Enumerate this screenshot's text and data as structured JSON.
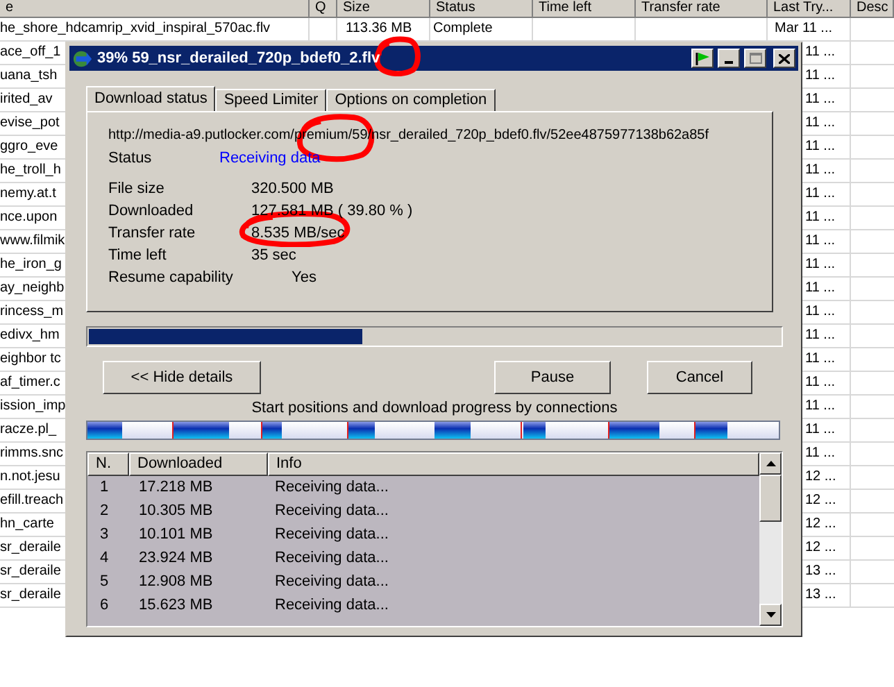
{
  "file_list": {
    "columns": [
      "e",
      "Q",
      "Size",
      "Status",
      "Time left",
      "Transfer rate",
      "Last Try...",
      "Desc"
    ],
    "rows": [
      {
        "name": "he_shore_hdcamrip_xvid_inspiral_570ac.flv",
        "size": "113.36  MB",
        "status": "Complete",
        "last_try": "Mar 11 ..."
      },
      {
        "name": "ace_off_1",
        "last_try": "11 ..."
      },
      {
        "name": "uana_tsh",
        "last_try": "11 ..."
      },
      {
        "name": "irited_av",
        "last_try": "11 ..."
      },
      {
        "name": "evise_pot",
        "last_try": "11 ..."
      },
      {
        "name": "ggro_eve",
        "last_try": "11 ..."
      },
      {
        "name": "he_troll_h",
        "last_try": "11 ..."
      },
      {
        "name": "nemy.at.t",
        "last_try": "11 ..."
      },
      {
        "name": "nce.upon",
        "last_try": "11 ..."
      },
      {
        "name": "www.filmik",
        "last_try": "11 ..."
      },
      {
        "name": "he_iron_g",
        "last_try": "11 ..."
      },
      {
        "name": "ay_neighb",
        "last_try": "11 ..."
      },
      {
        "name": "rincess_m",
        "last_try": "11 ..."
      },
      {
        "name": "edivx_hm",
        "last_try": "11 ..."
      },
      {
        "name": "eighbor tc",
        "last_try": "11 ..."
      },
      {
        "name": "af_timer.c",
        "last_try": "11 ..."
      },
      {
        "name": "ission_imp",
        "last_try": "11 ..."
      },
      {
        "name": "racze.pl_",
        "last_try": "11 ..."
      },
      {
        "name": "rimms.snc",
        "last_try": "11 ..."
      },
      {
        "name": "n.not.jesu",
        "last_try": "12 ..."
      },
      {
        "name": "efill.treach",
        "last_try": "12 ..."
      },
      {
        "name": "hn_carte",
        "last_try": "12 ..."
      },
      {
        "name": "sr_deraile",
        "last_try": "12 ..."
      },
      {
        "name": "sr_deraile",
        "last_try": "13 ..."
      },
      {
        "name": "sr_deraile",
        "last_try": "13 ..."
      }
    ]
  },
  "dialog": {
    "title": "39% 59_nsr_derailed_720p_bdef0_2.flv",
    "tabs": [
      {
        "label": "Download status",
        "selected": true
      },
      {
        "label": "Speed Limiter",
        "selected": false
      },
      {
        "label": "Options on completion",
        "selected": false
      }
    ],
    "url": "http://media-a9.putlocker.com/premium/59/nsr_derailed_720p_bdef0.flv/52ee4875977138b62a85f",
    "status": {
      "label": "Status",
      "value": "Receiving data"
    },
    "details": [
      {
        "label": "File size",
        "value": "320.500  MB",
        "kind": "plain"
      },
      {
        "label": "Downloaded",
        "value": "127.581  MB  ( 39.80 % )",
        "kind": "plain"
      },
      {
        "label": "Transfer rate",
        "value": "8.535  MB/sec",
        "kind": "plain"
      },
      {
        "label": "Time left",
        "value": "35 sec",
        "kind": "plain"
      },
      {
        "label": "Resume capability",
        "value": "Yes",
        "kind": "indented"
      }
    ],
    "progress": {
      "level": 0.396
    },
    "buttons": {
      "details": "<< Hide details",
      "pause": "Pause",
      "cancel": "Cancel"
    },
    "connections_caption": "Start positions and download progress by connections",
    "connections": {
      "columns": [
        "N.",
        "Downloaded",
        "Info"
      ],
      "rows": [
        [
          "1",
          "17.218  MB",
          "Receiving data..."
        ],
        [
          "2",
          "10.305  MB",
          "Receiving data..."
        ],
        [
          "3",
          "10.101  MB",
          "Receiving data..."
        ],
        [
          "4",
          "23.924  MB",
          "Receiving data..."
        ],
        [
          "5",
          "12.908  MB",
          "Receiving data..."
        ],
        [
          "6",
          "15.623  MB",
          "Receiving data..."
        ]
      ]
    }
  }
}
